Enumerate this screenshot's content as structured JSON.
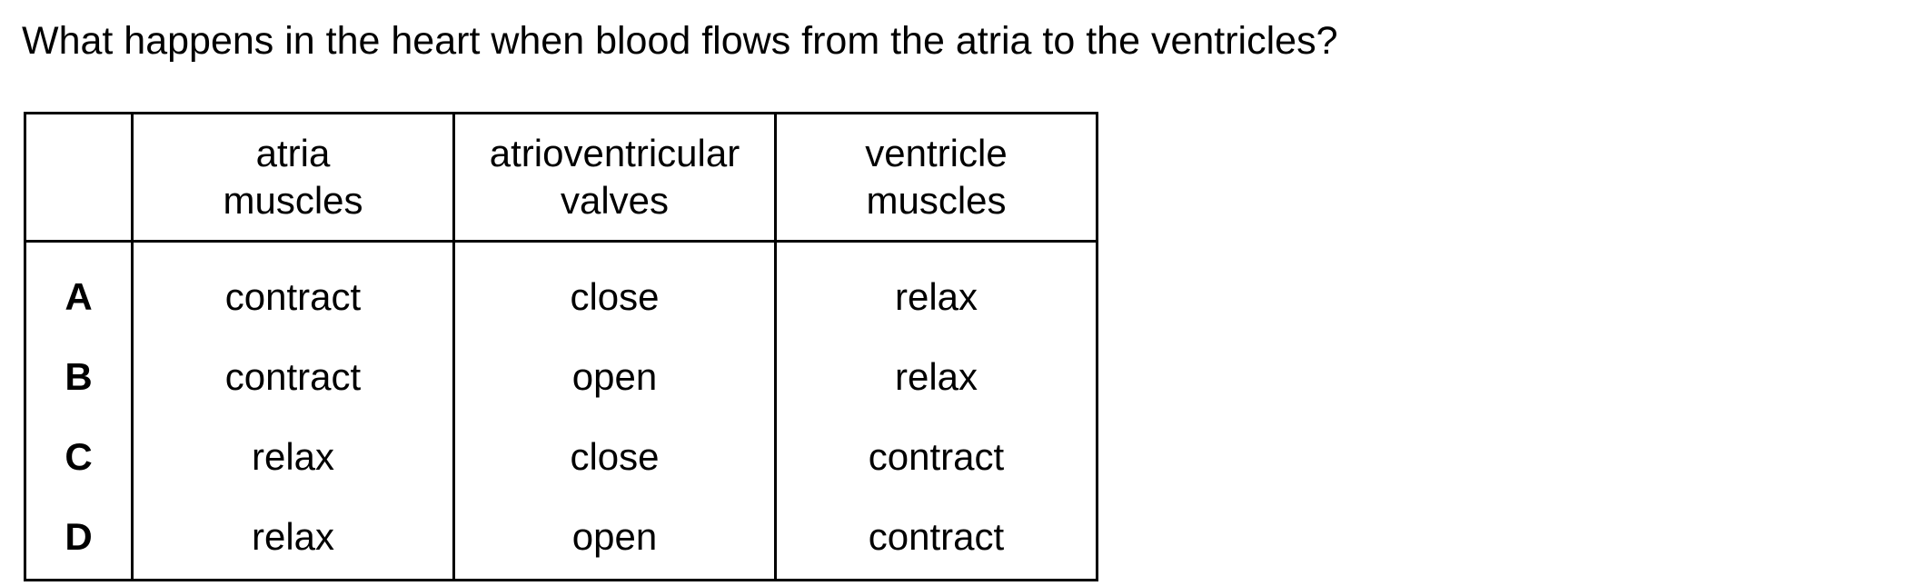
{
  "question": "What happens in the heart when blood flows from the atria to the ventricles?",
  "table": {
    "headers": [
      {
        "lines": []
      },
      {
        "lines": [
          "atria",
          "muscles"
        ]
      },
      {
        "lines": [
          "atrioventricular",
          "valves"
        ]
      },
      {
        "lines": [
          "ventricle",
          "muscles"
        ]
      }
    ],
    "rows": [
      {
        "option": "A",
        "atria_muscles": "contract",
        "av_valves": "close",
        "ventricle_muscles": "relax"
      },
      {
        "option": "B",
        "atria_muscles": "contract",
        "av_valves": "open",
        "ventricle_muscles": "relax"
      },
      {
        "option": "C",
        "atria_muscles": "relax",
        "av_valves": "close",
        "ventricle_muscles": "contract"
      },
      {
        "option": "D",
        "atria_muscles": "relax",
        "av_valves": "open",
        "ventricle_muscles": "contract"
      }
    ]
  }
}
